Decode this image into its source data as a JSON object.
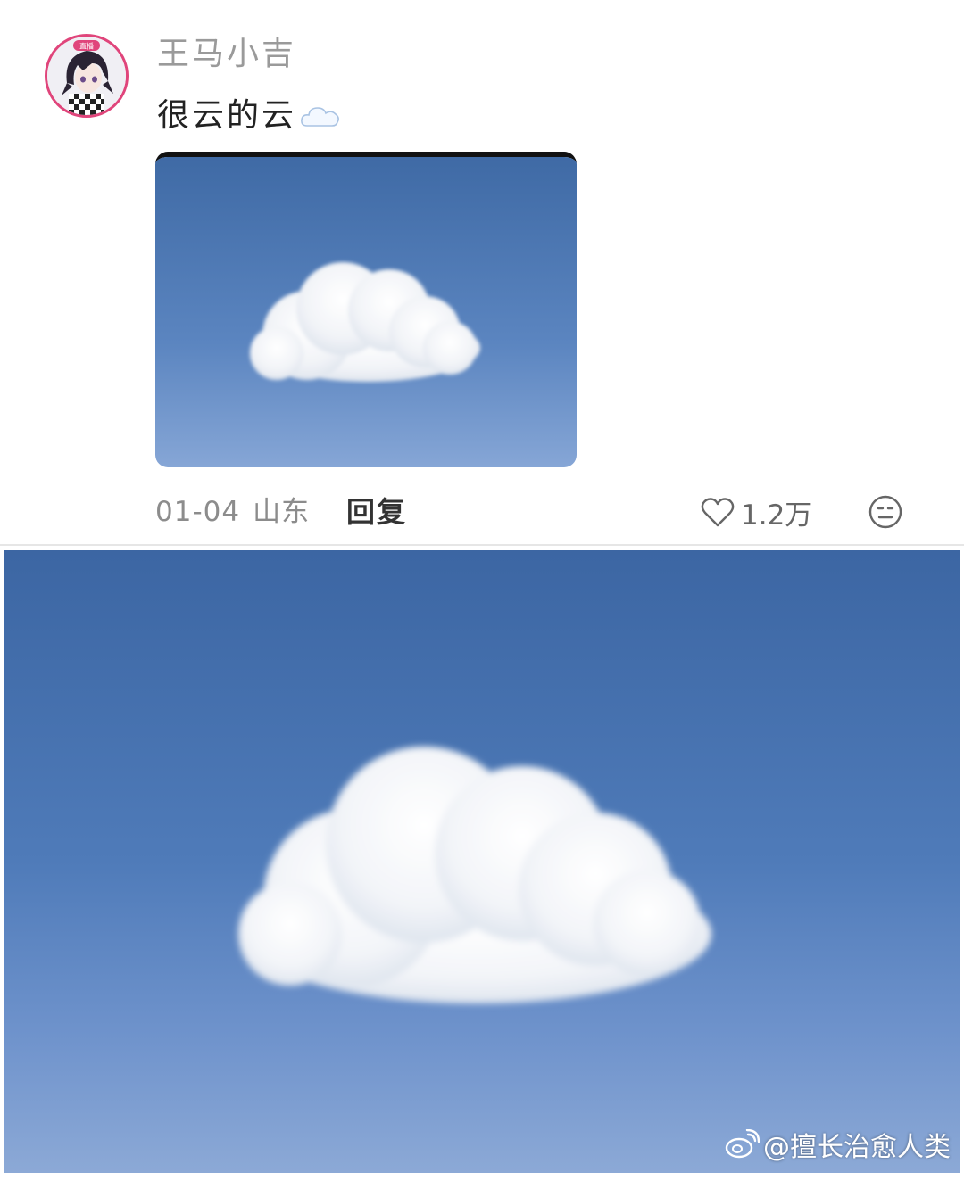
{
  "post": {
    "username": "王马小吉",
    "text": "很云的云",
    "text_emoji_icon": "cloud-emoji-icon",
    "date": "01-04",
    "location": "山东",
    "reply_label": "回复",
    "like_count": "1.2万",
    "avatar_badge": "直播"
  },
  "watermark": {
    "text": "@擅长治愈人类",
    "icon": "weibo-logo-icon"
  },
  "colors": {
    "avatar_ring": "#e0457b",
    "sky_top": "#3d6aa7",
    "sky_bottom": "#86a6d6"
  }
}
